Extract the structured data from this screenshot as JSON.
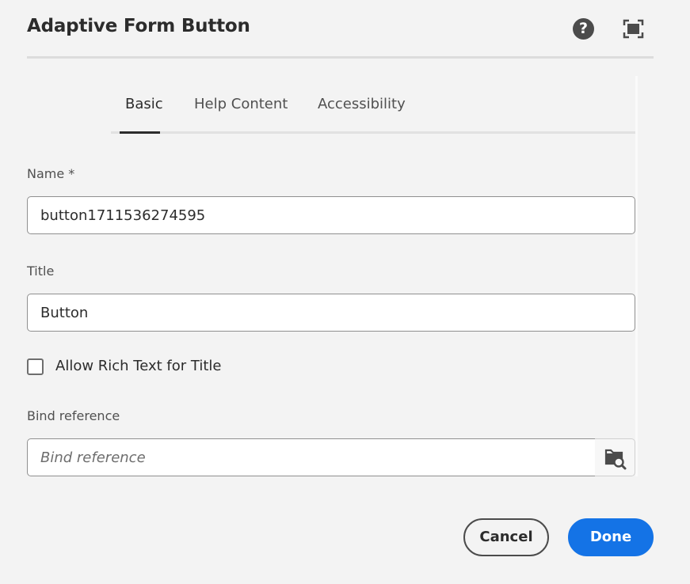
{
  "dialog": {
    "title": "Adaptive Form Button",
    "help_icon": "help-icon",
    "help_glyph": "?",
    "fullscreen_icon": "fullscreen-icon"
  },
  "tabs": [
    {
      "label": "Basic",
      "active": true
    },
    {
      "label": "Help Content",
      "active": false
    },
    {
      "label": "Accessibility",
      "active": false
    }
  ],
  "fields": {
    "name": {
      "label": "Name *",
      "value": "button1711536274595"
    },
    "title": {
      "label": "Title",
      "value": "Button"
    },
    "allow_rich_text": {
      "label": "Allow Rich Text for Title",
      "checked": false
    },
    "bind_reference": {
      "label": "Bind reference",
      "placeholder": "Bind reference",
      "value": "",
      "browse_icon": "folder-search-icon"
    }
  },
  "footer": {
    "cancel_label": "Cancel",
    "done_label": "Done"
  },
  "colors": {
    "accent": "#1473e6",
    "background": "#f3f3f3"
  }
}
